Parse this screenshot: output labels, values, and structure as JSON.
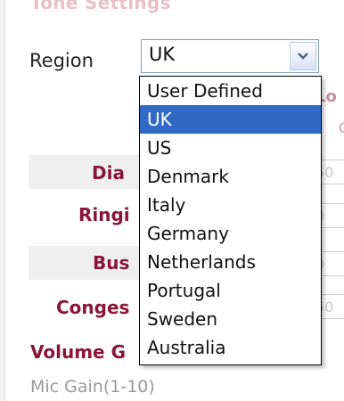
{
  "section": {
    "title": "Tone Settings"
  },
  "region": {
    "label": "Region",
    "selected": "UK",
    "options": [
      "User Defined",
      "UK",
      "US",
      "Denmark",
      "Italy",
      "Germany",
      "Netherlands",
      "Portugal",
      "Sweden",
      "Australia"
    ]
  },
  "rows": [
    {
      "label": "Dia"
    },
    {
      "label": "Ringi"
    },
    {
      "label": "Bus"
    },
    {
      "label": "Conges"
    }
  ],
  "ghost_inputs": [
    "50",
    "0",
    "0",
    "50"
  ],
  "ghost_text": {
    "header": "Lo",
    "sub": "C"
  },
  "volume": {
    "title": "Volume G",
    "mic_label": "Mic Gain(1-10)"
  },
  "colors": {
    "label_red": "#8a1538",
    "highlight": "#316ac5"
  }
}
